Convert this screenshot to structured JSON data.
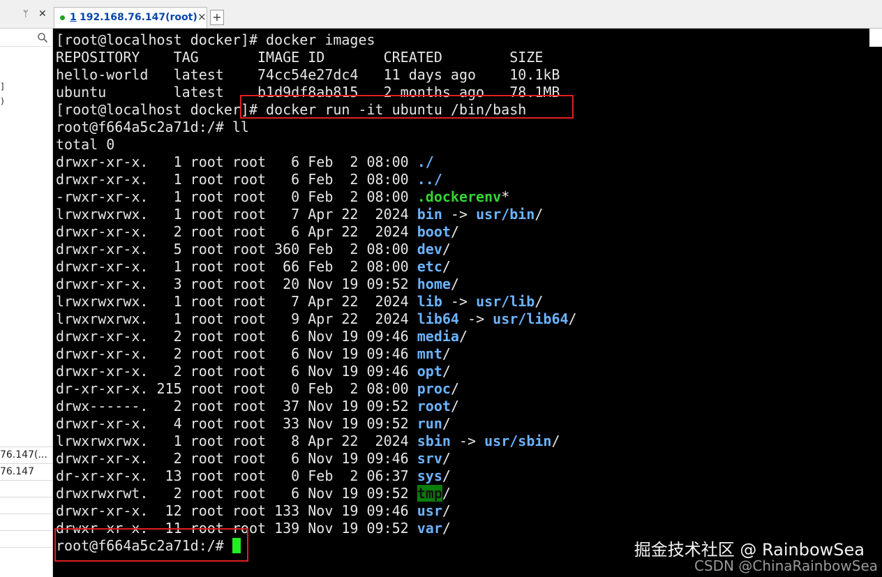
{
  "tab": {
    "number": "1",
    "title": "192.168.76.147(root)",
    "close_glyph": "×",
    "add_glyph": "+"
  },
  "sidebar": {
    "pin_glyph": "ᛘ",
    "close_glyph": "✕",
    "fragments": [
      "]",
      ")"
    ],
    "rows": [
      "76.147(...",
      "76.147"
    ]
  },
  "terminal": {
    "lines": [
      [
        {
          "t": "[root@localhost docker]# docker images"
        }
      ],
      [
        {
          "t": "REPOSITORY    TAG       IMAGE ID       CREATED        SIZE"
        }
      ],
      [
        {
          "t": "hello-world   latest    74cc54e27dc4   11 days ago    10.1kB"
        }
      ],
      [
        {
          "t": "ubuntu        latest    b1d9df8ab815   2 months ago   78.1MB"
        }
      ],
      [
        {
          "t": "[root@localhost docker]# docker run -it ubuntu /bin/bash"
        }
      ],
      [
        {
          "t": "root@f664a5c2a71d:/# ll"
        }
      ],
      [
        {
          "t": "total 0"
        }
      ],
      [
        {
          "t": "drwxr-xr-x.   1 root root   6 Feb  2 08:00 "
        },
        {
          "t": "./",
          "c": "dir"
        }
      ],
      [
        {
          "t": "drwxr-xr-x.   1 root root   6 Feb  2 08:00 "
        },
        {
          "t": "../",
          "c": "dir"
        }
      ],
      [
        {
          "t": "-rwxr-xr-x.   1 root root   0 Feb  2 08:00 "
        },
        {
          "t": ".dockerenv",
          "c": "green"
        },
        {
          "t": "*"
        }
      ],
      [
        {
          "t": "lrwxrwxrwx.   1 root root   7 Apr 22  2024 "
        },
        {
          "t": "bin",
          "c": "dir"
        },
        {
          "t": " -> "
        },
        {
          "t": "usr/bin",
          "c": "dir"
        },
        {
          "t": "/"
        }
      ],
      [
        {
          "t": "drwxr-xr-x.   2 root root   6 Apr 22  2024 "
        },
        {
          "t": "boot",
          "c": "dir"
        },
        {
          "t": "/"
        }
      ],
      [
        {
          "t": "drwxr-xr-x.   5 root root 360 Feb  2 08:00 "
        },
        {
          "t": "dev",
          "c": "dir"
        },
        {
          "t": "/"
        }
      ],
      [
        {
          "t": "drwxr-xr-x.   1 root root  66 Feb  2 08:00 "
        },
        {
          "t": "etc",
          "c": "dir"
        },
        {
          "t": "/"
        }
      ],
      [
        {
          "t": "drwxr-xr-x.   3 root root  20 Nov 19 09:52 "
        },
        {
          "t": "home",
          "c": "dir"
        },
        {
          "t": "/"
        }
      ],
      [
        {
          "t": "lrwxrwxrwx.   1 root root   7 Apr 22  2024 "
        },
        {
          "t": "lib",
          "c": "dir"
        },
        {
          "t": " -> "
        },
        {
          "t": "usr/lib",
          "c": "dir"
        },
        {
          "t": "/"
        }
      ],
      [
        {
          "t": "lrwxrwxrwx.   1 root root   9 Apr 22  2024 "
        },
        {
          "t": "lib64",
          "c": "dir"
        },
        {
          "t": " -> "
        },
        {
          "t": "usr/lib64",
          "c": "dir"
        },
        {
          "t": "/"
        }
      ],
      [
        {
          "t": "drwxr-xr-x.   2 root root   6 Nov 19 09:46 "
        },
        {
          "t": "media",
          "c": "dir"
        },
        {
          "t": "/"
        }
      ],
      [
        {
          "t": "drwxr-xr-x.   2 root root   6 Nov 19 09:46 "
        },
        {
          "t": "mnt",
          "c": "dir"
        },
        {
          "t": "/"
        }
      ],
      [
        {
          "t": "drwxr-xr-x.   2 root root   6 Nov 19 09:46 "
        },
        {
          "t": "opt",
          "c": "dir"
        },
        {
          "t": "/"
        }
      ],
      [
        {
          "t": "dr-xr-xr-x. 215 root root   0 Feb  2 08:00 "
        },
        {
          "t": "proc",
          "c": "dir"
        },
        {
          "t": "/"
        }
      ],
      [
        {
          "t": "drwx------.   2 root root  37 Nov 19 09:52 "
        },
        {
          "t": "root",
          "c": "dir"
        },
        {
          "t": "/"
        }
      ],
      [
        {
          "t": "drwxr-xr-x.   4 root root  33 Nov 19 09:52 "
        },
        {
          "t": "run",
          "c": "dir"
        },
        {
          "t": "/"
        }
      ],
      [
        {
          "t": "lrwxrwxrwx.   1 root root   8 Apr 22  2024 "
        },
        {
          "t": "sbin",
          "c": "dir"
        },
        {
          "t": " -> "
        },
        {
          "t": "usr/sbin",
          "c": "dir"
        },
        {
          "t": "/"
        }
      ],
      [
        {
          "t": "drwxr-xr-x.   2 root root   6 Nov 19 09:46 "
        },
        {
          "t": "srv",
          "c": "dir"
        },
        {
          "t": "/"
        }
      ],
      [
        {
          "t": "dr-xr-xr-x.  13 root root   0 Feb  2 06:37 "
        },
        {
          "t": "sys",
          "c": "dir"
        },
        {
          "t": "/"
        }
      ],
      [
        {
          "t": "drwxrwxrwt.   2 root root   6 Nov 19 09:52 "
        },
        {
          "t": "tmp",
          "c": "hl"
        },
        {
          "t": "/"
        }
      ],
      [
        {
          "t": "drwxr-xr-x.  12 root root 133 Nov 19 09:46 "
        },
        {
          "t": "usr",
          "c": "dir"
        },
        {
          "t": "/"
        }
      ],
      [
        {
          "t": "drwxr-xr-x.  11 root root 139 Nov 19 09:52 "
        },
        {
          "t": "var",
          "c": "dir"
        },
        {
          "t": "/"
        }
      ],
      [
        {
          "t": "root@f664a5c2a71d:/# "
        },
        {
          "cursor": true
        }
      ]
    ]
  },
  "watermark": {
    "line1": "掘金技术社区 @ RainbowSea",
    "line2": "CSDN @ChinaRainbowSea"
  },
  "colors": {
    "background": "#000000",
    "foreground": "#e6e6e6",
    "directory": "#6cb4ff",
    "executable": "#33d633",
    "cursor": "#22ee22",
    "highlight_box": "#e02020",
    "tab_text": "#0645ad"
  }
}
